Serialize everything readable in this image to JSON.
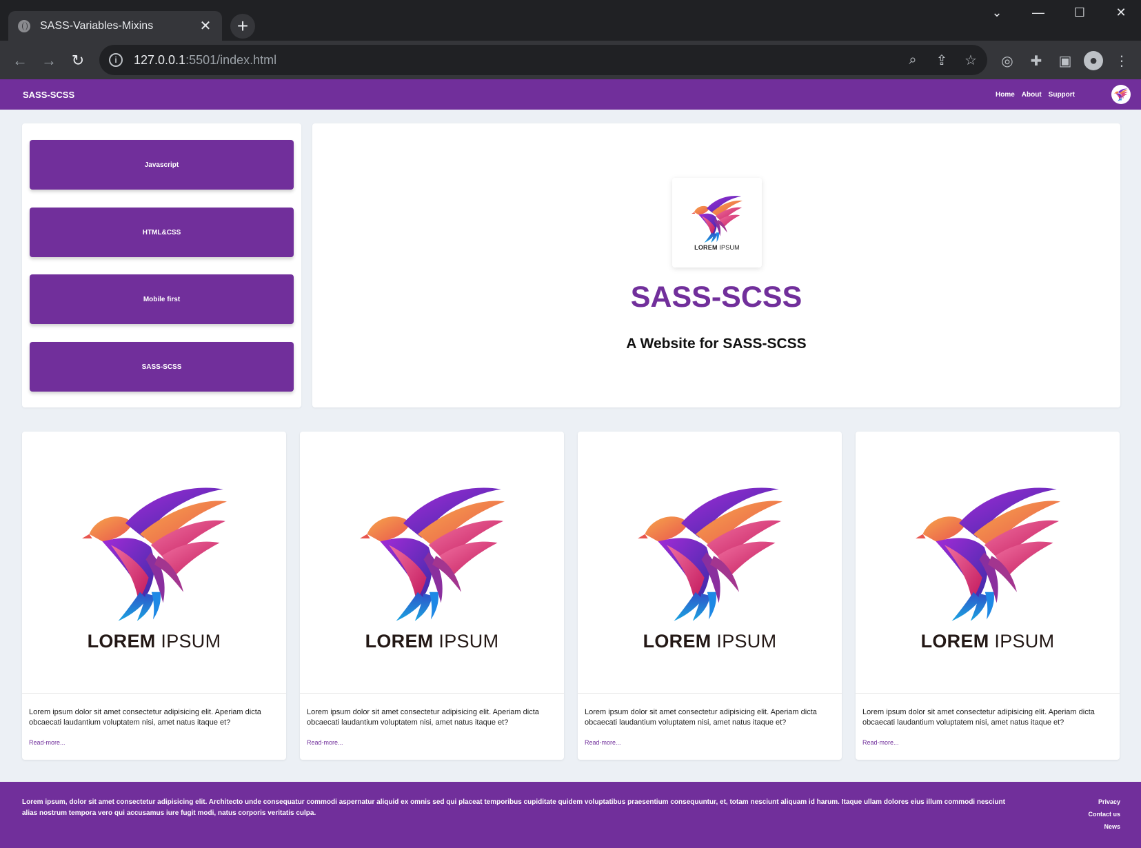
{
  "browser": {
    "tab_title": "SASS-Variables-Mixins",
    "url_host": "127.0.0.1",
    "url_rest": ":5501/index.html"
  },
  "site": {
    "brand": "SASS-SCSS",
    "nav": [
      "Home",
      "About",
      "Support"
    ],
    "accent_color": "#712f9b"
  },
  "sidebar": {
    "buttons": [
      "Javascript",
      "HTML&CSS",
      "Mobile first",
      "SASS-SCSS"
    ]
  },
  "hero": {
    "logo_text_bold": "LOREM",
    "logo_text_light": "IPSUM",
    "title": "SASS-SCSS",
    "subtitle": "A Website for SASS-SCSS"
  },
  "cards": [
    {
      "logo_bold": "LOREM",
      "logo_light": "IPSUM",
      "text": "Lorem ipsum dolor sit amet consectetur adipisicing elit. Aperiam dicta obcaecati laudantium voluptatem nisi, amet natus itaque et?",
      "link": "Read-more..."
    },
    {
      "logo_bold": "LOREM",
      "logo_light": "IPSUM",
      "text": "Lorem ipsum dolor sit amet consectetur adipisicing elit. Aperiam dicta obcaecati laudantium voluptatem nisi, amet natus itaque et?",
      "link": "Read-more..."
    },
    {
      "logo_bold": "LOREM",
      "logo_light": "IPSUM",
      "text": "Lorem ipsum dolor sit amet consectetur adipisicing elit. Aperiam dicta obcaecati laudantium voluptatem nisi, amet natus itaque et?",
      "link": "Read-more..."
    },
    {
      "logo_bold": "LOREM",
      "logo_light": "IPSUM",
      "text": "Lorem ipsum dolor sit amet consectetur adipisicing elit. Aperiam dicta obcaecati laudantium voluptatem nisi, amet natus itaque et?",
      "link": "Read-more..."
    }
  ],
  "footer": {
    "text": "Lorem ipsum, dolor sit amet consectetur adipisicing elit. Architecto unde consequatur commodi aspernatur aliquid ex omnis sed qui placeat temporibus cupiditate quidem voluptatibus praesentium consequuntur, et, totam nesciunt aliquam id harum. Itaque ullam dolores eius illum commodi nesciunt alias nostrum tempora vero qui accusamus iure fugit modi, natus corporis veritatis culpa.",
    "links": [
      "Privacy",
      "Contact us",
      "News"
    ]
  }
}
